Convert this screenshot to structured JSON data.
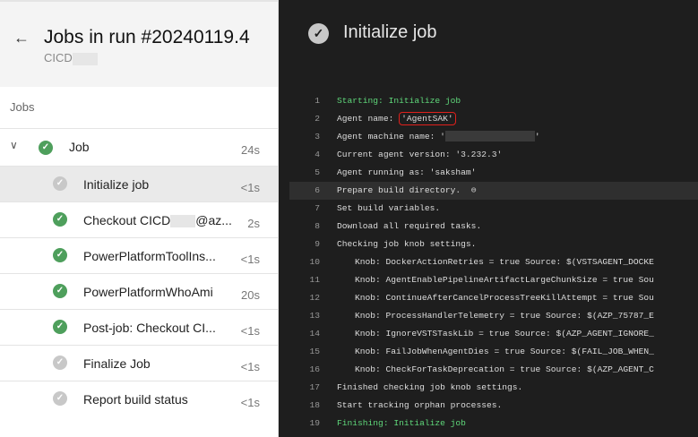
{
  "header": {
    "back_icon": "arrow-left-icon",
    "title": "Jobs in run #20240119.4",
    "subtitle": "CICD"
  },
  "jobs_label": "Jobs",
  "job": {
    "name": "Job",
    "duration": "24s",
    "status": "succeeded"
  },
  "steps": [
    {
      "name": "Initialize job",
      "duration": "<1s",
      "status": "neutral",
      "selected": true
    },
    {
      "name": "Checkout CICD",
      "name_suffix": "@az...",
      "duration": "2s",
      "status": "succeeded"
    },
    {
      "name": "PowerPlatformToolIns...",
      "duration": "<1s",
      "status": "succeeded"
    },
    {
      "name": "PowerPlatformWhoAmi",
      "duration": "20s",
      "status": "succeeded"
    },
    {
      "name": "Post-job: Checkout CI...",
      "duration": "<1s",
      "status": "succeeded"
    },
    {
      "name": "Finalize Job",
      "duration": "<1s",
      "status": "neutral"
    },
    {
      "name": "Report build status",
      "duration": "<1s",
      "status": "neutral"
    }
  ],
  "log": {
    "title": "Initialize job",
    "lines": [
      {
        "n": "1",
        "t": "Starting: Initialize job"
      },
      {
        "n": "2",
        "t": "Agent name: ",
        "v": "'AgentSAK'"
      },
      {
        "n": "3",
        "t": "Agent machine name: '",
        "v": "'"
      },
      {
        "n": "4",
        "t": "Current agent version: '3.232.3'"
      },
      {
        "n": "5",
        "t": "Agent running as: 'saksham'"
      },
      {
        "n": "6",
        "t": "Prepare build directory.  ",
        "v": "link-icon"
      },
      {
        "n": "7",
        "t": "Set build variables."
      },
      {
        "n": "8",
        "t": "Download all required tasks."
      },
      {
        "n": "9",
        "t": "Checking job knob settings."
      },
      {
        "n": "10",
        "t": "Knob: DockerActionRetries = true Source: $(VSTSAGENT_DOCKE"
      },
      {
        "n": "11",
        "t": "Knob: AgentEnablePipelineArtifactLargeChunkSize = true Sou"
      },
      {
        "n": "12",
        "t": "Knob: ContinueAfterCancelProcessTreeKillAttempt = true Sou"
      },
      {
        "n": "13",
        "t": "Knob: ProcessHandlerTelemetry = true Source: $(AZP_75787_E"
      },
      {
        "n": "14",
        "t": "Knob: IgnoreVSTSTaskLib = true Source: $(AZP_AGENT_IGNORE_"
      },
      {
        "n": "15",
        "t": "Knob: FailJobWhenAgentDies = true Source: $(FAIL_JOB_WHEN_"
      },
      {
        "n": "16",
        "t": "Knob: CheckForTaskDeprecation = true Source: $(AZP_AGENT_C"
      },
      {
        "n": "17",
        "t": "Finished checking job knob settings."
      },
      {
        "n": "18",
        "t": "Start tracking orphan processes."
      },
      {
        "n": "19",
        "t": "Finishing: Initialize job"
      }
    ]
  },
  "colors": {
    "success": "#4e9f5c",
    "log_green": "#5fd77a",
    "highlight": "#e0201c"
  }
}
